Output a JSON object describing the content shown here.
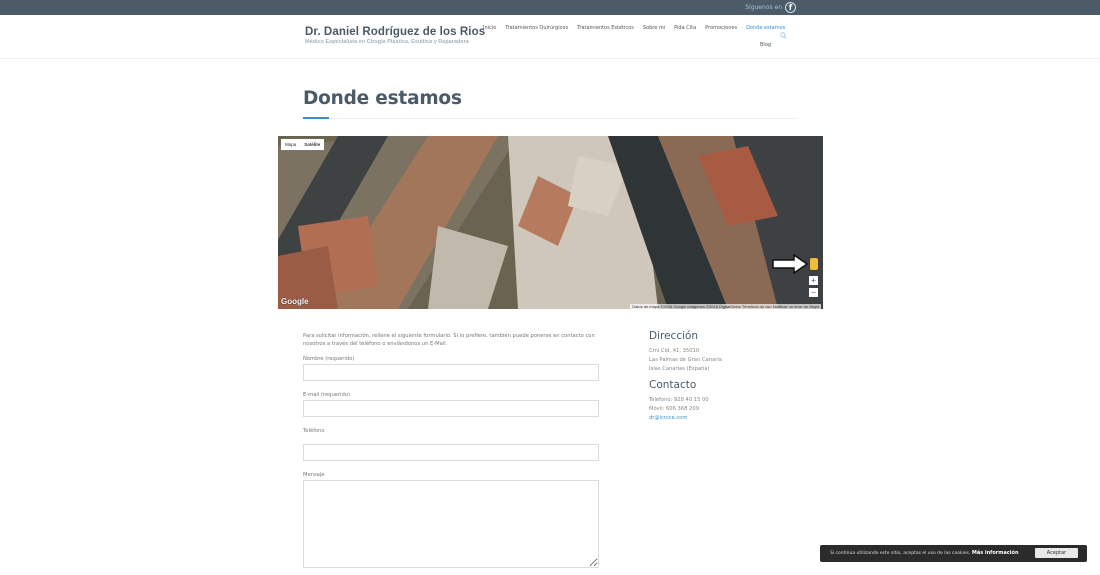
{
  "topbar": {
    "follow_text": "Síguenos en",
    "fb_glyph": "f",
    "bg_color": "#4d5b68"
  },
  "brand": {
    "name": "Dr. Daniel Rodríguez de los Rios",
    "tagline": "Médico Especialista en Cirugía Plástica, Estética y Reparadora"
  },
  "nav": {
    "items": [
      "Inicio",
      "Tratamientos Quirúrgicos",
      "Tratamientos Estéticos",
      "Sobre mi",
      "Pida Cita",
      "Promociones",
      "Donde estamos"
    ],
    "second_row": "Blog",
    "active": "Donde estamos",
    "active_color": "#2f8fcf"
  },
  "page": {
    "title": "Donde estamos"
  },
  "map": {
    "toggle_map": "Mapa",
    "toggle_satellite": "Satélite",
    "logo": "Google",
    "footer": "Datos de mapa ©2016 Google Imágenes ©2016 DigitalGlobe  Términos de uso  Notificar un error de Maps",
    "zoom_in": "+",
    "zoom_out": "−",
    "icons": [
      "pegman-icon",
      "arrow-right-icon"
    ]
  },
  "form": {
    "intro": "Para solicitar información, rellene el siguiente formulario. Si lo prefiere, también puede ponerse en contacto con nosotros a través del teléfono o enviándonos un E-Mail.",
    "name_label": "Nombre (requerido)",
    "email_label": "E-mail (requerido)",
    "phone_label": "Teléfono",
    "message_label": "Mensaje",
    "name_value": "",
    "email_value": "",
    "phone_value": "",
    "message_value": ""
  },
  "sidebar": {
    "address_title": "Dirección",
    "address_lines": [
      "Crnl Cid, 41, 35010",
      "Las Palmas de Gran Canaria",
      "Islas Canarias (España)"
    ],
    "contact_title": "Contacto",
    "phone": "Teléfono: 928 40 15 00",
    "mobile": "Móvil: 606 368 209",
    "email": "dr@icnice.com"
  },
  "cookie": {
    "text": "Si continúa utilizando este sitio, aceptas el uso de las cookies.",
    "more": "Más información",
    "accept": "Aceptar"
  }
}
